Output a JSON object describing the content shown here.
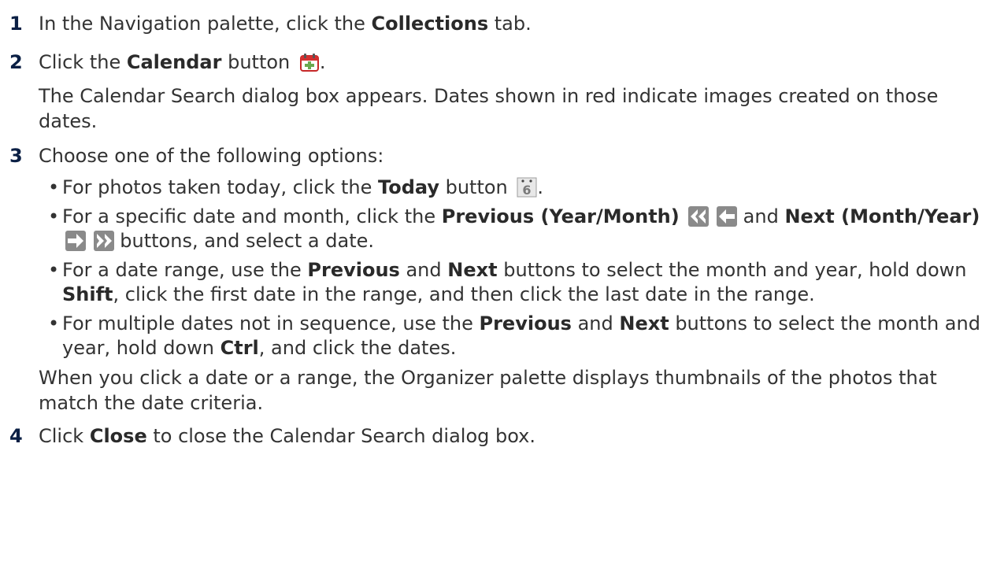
{
  "steps": [
    {
      "num": "1",
      "pre": "In the Navigation palette, click the ",
      "bold": "Collections",
      "post": " tab."
    },
    {
      "num": "2",
      "pre": "Click the ",
      "bold": "Calendar",
      "post": " button",
      "after_icon": ".",
      "icon": "calendar-icon",
      "desc": "The Calendar Search dialog box appears. Dates shown in red indicate images created on those dates."
    },
    {
      "num": "3",
      "text": "Choose one of the following options:",
      "bullets": {
        "today": {
          "pre": "For photos taken today, click the ",
          "bold": "Today",
          "post": " button",
          "after_icon": ".",
          "icon": "today-icon"
        },
        "specific": {
          "pre": "For a specific date and month, click the ",
          "bold1": "Previous (Year/Month)",
          "mid": " and ",
          "bold2": "Next (Month/Year)",
          "post": " buttons, and select a date.",
          "icons": [
            "previous-year-icon",
            "previous-month-icon",
            "next-month-icon",
            "next-year-icon"
          ]
        },
        "range": {
          "pre": "For a date range, use the ",
          "bold1": "Previous",
          "mid1": " and ",
          "bold2": "Next",
          "mid2": " buttons to select the month and year, hold down ",
          "bold3": "Shift",
          "post": ", click the first date in the range, and then click the last date in the range."
        },
        "multiple": {
          "pre": "For multiple dates not in sequence, use the ",
          "bold1": "Previous",
          "mid1": " and ",
          "bold2": "Next",
          "mid2": " buttons to select the month and year, hold down ",
          "bold3": "Ctrl",
          "post": ", and click the dates."
        }
      },
      "desc": "When you click a date or a range, the Organizer palette displays thumbnails of the photos that match the date criteria."
    },
    {
      "num": "4",
      "pre": "Click ",
      "bold": "Close",
      "post": " to close the Calendar Search dialog box."
    }
  ],
  "colors": {
    "text": "#333333",
    "step_number": "#0a1f44",
    "calendar_red": "#d32f2f"
  }
}
